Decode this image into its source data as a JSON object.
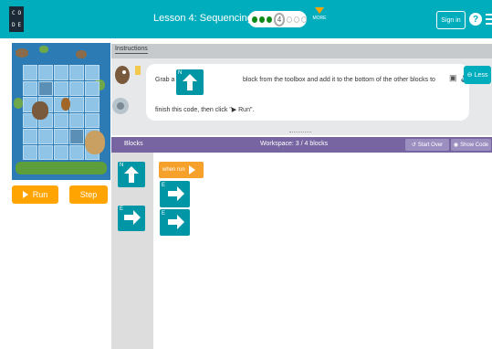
{
  "header": {
    "logo_letters": [
      "C",
      "O",
      "D",
      "E"
    ],
    "lesson_title": "Lesson 4: Sequencing with Scrat",
    "current_level": "4",
    "more_label": "MORE",
    "sign_in_label": "Sign in",
    "help_label": "?"
  },
  "controls": {
    "run_label": "Run",
    "step_label": "Step"
  },
  "instructions": {
    "tab_label": "Instructions",
    "text_before_block": "Grab a",
    "inline_block_direction": "N",
    "text_after_block": "block from the toolbox and add it to the bottom of the other blocks to",
    "text_line2": "finish this code, then click \"▶ Run\".",
    "less_label": "Less"
  },
  "workspace": {
    "blocks_label": "Blocks",
    "workspace_label": "Workspace: 3 / 4 blocks",
    "start_over_label": "Start Over",
    "show_code_label": "Show Code",
    "when_run_label": "when run"
  },
  "toolbox_blocks": [
    {
      "direction": "N",
      "icon": "arrow-up-icon"
    },
    {
      "direction": "E",
      "icon": "arrow-right-icon"
    }
  ],
  "program_blocks": [
    {
      "direction": "E",
      "icon": "arrow-right-icon"
    },
    {
      "direction": "E",
      "icon": "arrow-right-icon"
    }
  ],
  "colors": {
    "header": "#00adbc",
    "run_orange": "#ffa400",
    "block_teal": "#0096a6",
    "event_orange": "#f5a12b",
    "workspace_header": "#7665a0"
  }
}
